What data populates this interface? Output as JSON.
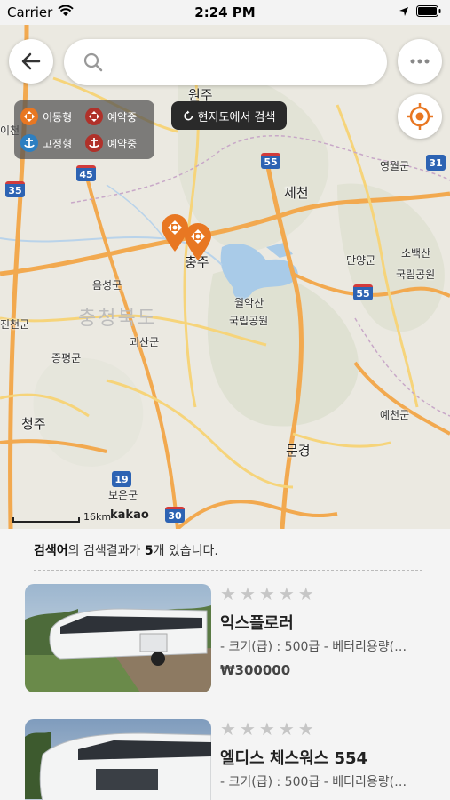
{
  "status_bar": {
    "carrier": "Carrier",
    "time": "2:24 PM"
  },
  "search": {
    "placeholder": "",
    "value": ""
  },
  "legend": {
    "items": [
      {
        "label": "이동형",
        "icon": "mobile-type-icon",
        "color": "#e87722"
      },
      {
        "label": "예약중",
        "icon": "mobile-reserved-icon",
        "color": "#b0312a"
      },
      {
        "label": "고정형",
        "icon": "fixed-type-icon",
        "color": "#2d7fc1"
      },
      {
        "label": "예약중",
        "icon": "fixed-reserved-icon",
        "color": "#b0312a"
      }
    ]
  },
  "map": {
    "search_here_label": "현지도에서 검색",
    "scale_label": "16km",
    "provider": "kakao",
    "labels": {
      "wonju": "원주",
      "jecheon": "제천",
      "chungju": "충주",
      "eumseong": "음성군",
      "chungbuk": "충청북도",
      "goesan": "괴산군",
      "jeungpyeong": "증평군",
      "cheongju": "청주",
      "mungyeong": "문경",
      "danyang": "단양군",
      "sobaeksan": "소백산",
      "sobaeksan_park": "국립공원",
      "woraksan": "월악산",
      "woraksan_park": "국립공원",
      "yeongwol": "영월군",
      "yecheon": "예천군",
      "boeun": "보은군",
      "icheon": "이천",
      "jincheon": "진천군"
    },
    "shields": [
      "35",
      "45",
      "55",
      "31",
      "55",
      "19",
      "30"
    ]
  },
  "results": {
    "keyword": "검색어",
    "text_mid": "의 검색결과가 ",
    "count": "5",
    "text_end": "개 있습니다.",
    "items": [
      {
        "title": "익스플로러",
        "spec": "- 크기(급) : 500급 - 베터리용량(…",
        "price": "₩300000",
        "rating_stars": 5
      },
      {
        "title": "엘디스 체스워스 554",
        "spec": "- 크기(급) : 500급 - 베터리용량(…",
        "price": "",
        "rating_stars": 5
      }
    ]
  }
}
